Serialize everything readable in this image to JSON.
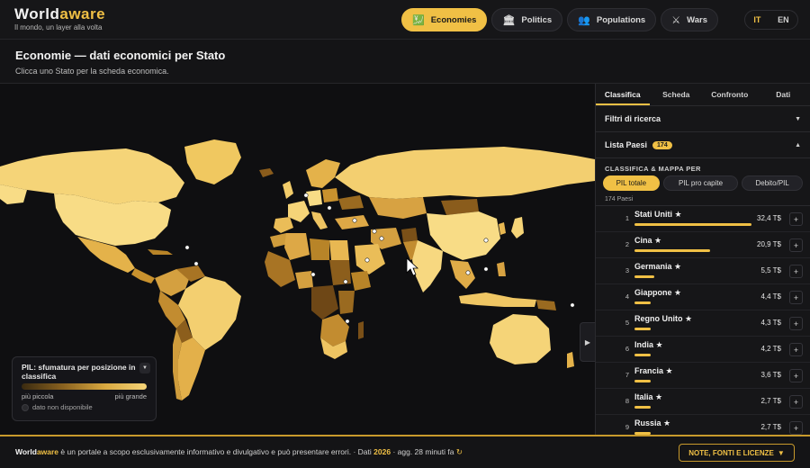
{
  "brand": {
    "name_part1": "World",
    "name_part2": "aware",
    "tagline": "Il mondo, un layer alla volta"
  },
  "nav": [
    {
      "label": "Economies",
      "icon": "chart-icon",
      "glyph": "💹",
      "active": true
    },
    {
      "label": "Politics",
      "icon": "government-icon",
      "glyph": "🏛",
      "active": false
    },
    {
      "label": "Populations",
      "icon": "people-icon",
      "glyph": "👥",
      "active": false
    },
    {
      "label": "Wars",
      "icon": "crossed-swords-icon",
      "glyph": "⚔",
      "active": false
    }
  ],
  "lang": {
    "it": "IT",
    "en": "EN",
    "selected": "IT"
  },
  "page": {
    "title": "Economie — dati economici per Stato",
    "subtitle": "Clicca uno Stato per la scheda economica."
  },
  "legend": {
    "title": "PIL: sfumatura per posizione in classifica",
    "min_label": "più piccola",
    "max_label": "più grande",
    "na_label": "dato non disponibile"
  },
  "panel": {
    "tabs": [
      "Classifica",
      "Scheda",
      "Confronto",
      "Dati"
    ],
    "active_tab": "Classifica",
    "filters_label": "Filtri di ricerca",
    "list_label": "Lista Paesi",
    "list_count": "174",
    "rank_by_label": "CLASSIFICA & MAPPA PER",
    "metrics": [
      "PIL totale",
      "PIL pro capite",
      "Debito/PIL"
    ],
    "active_metric": "PIL totale",
    "countries_count": "174 Paesi",
    "rows": [
      {
        "rank": "1",
        "name": "Stati Uniti ★",
        "value": "32,4 T$",
        "share": 1.0
      },
      {
        "rank": "2",
        "name": "Cina ★",
        "value": "20,9 T$",
        "share": 0.645
      },
      {
        "rank": "3",
        "name": "Germania ★",
        "value": "5,5 T$",
        "share": 0.17
      },
      {
        "rank": "4",
        "name": "Giappone ★",
        "value": "4,4 T$",
        "share": 0.136
      },
      {
        "rank": "5",
        "name": "Regno Unito ★",
        "value": "4,3 T$",
        "share": 0.133
      },
      {
        "rank": "6",
        "name": "India ★",
        "value": "4,2 T$",
        "share": 0.13
      },
      {
        "rank": "7",
        "name": "Francia ★",
        "value": "3,6 T$",
        "share": 0.111
      },
      {
        "rank": "8",
        "name": "Italia ★",
        "value": "2,7 T$",
        "share": 0.083
      },
      {
        "rank": "9",
        "name": "Russia ★",
        "value": "2,7 T$",
        "share": 0.083
      }
    ]
  },
  "footer": {
    "brand_part1": "World",
    "brand_part2": "aware",
    "text": " è un portale a scopo esclusivamente informativo e divulgativo e può presentare errori. · Dati ",
    "year": "2026",
    "updated": " · agg. 28 minuti fa ",
    "refresh_glyph": "↻",
    "button": "NOTE, FONTI E LICENZE",
    "button_glyph": "▼"
  },
  "colors": {
    "accent": "#f0c045",
    "background": "#111113",
    "panel": "#161618"
  }
}
